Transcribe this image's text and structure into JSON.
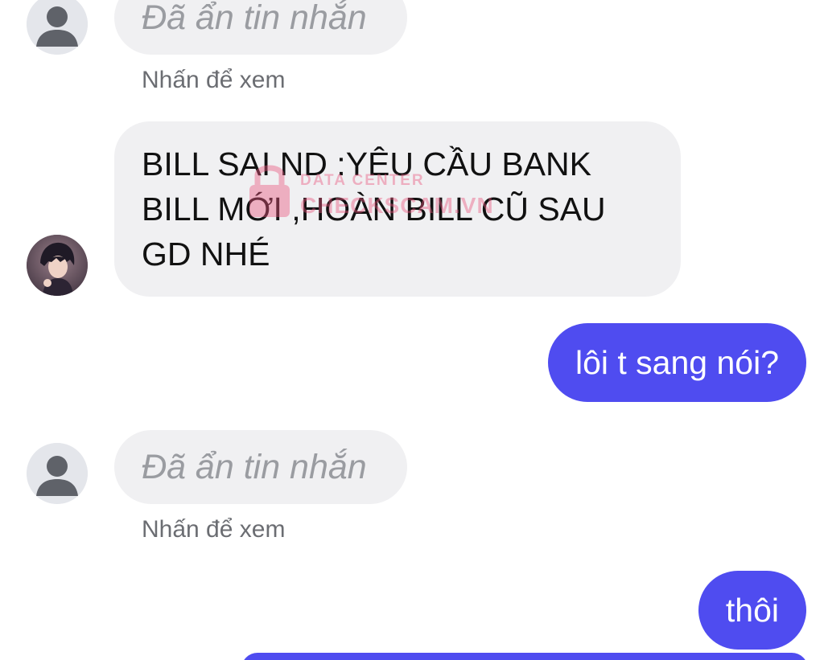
{
  "messages": [
    {
      "type": "received-hidden",
      "text": "Đã ẩn tin nhắn",
      "subtext": "Nhấn để xem",
      "avatar_icon": "default-user-icon"
    },
    {
      "type": "received-text",
      "text": "BILL SAI ND :YÊU CẦU BANK BILL MỚI ,HOÀN BILL CŨ SAU GD NHÉ",
      "avatar_icon": "user-photo-icon"
    },
    {
      "type": "sent",
      "text": "lôi t sang nói?"
    },
    {
      "type": "received-hidden",
      "text": "Đã ẩn tin nhắn",
      "subtext": "Nhấn để xem",
      "avatar_icon": "default-user-icon"
    },
    {
      "type": "sent",
      "text": "thôi"
    }
  ],
  "watermark": {
    "line1": "DATA CENTER",
    "line2": "CHECKSCAM.VN",
    "color": "#e9557d"
  },
  "colors": {
    "sent_bubble": "#4f4cf0",
    "received_bubble": "#f0f0f2",
    "hidden_text": "#9a9ca1"
  }
}
